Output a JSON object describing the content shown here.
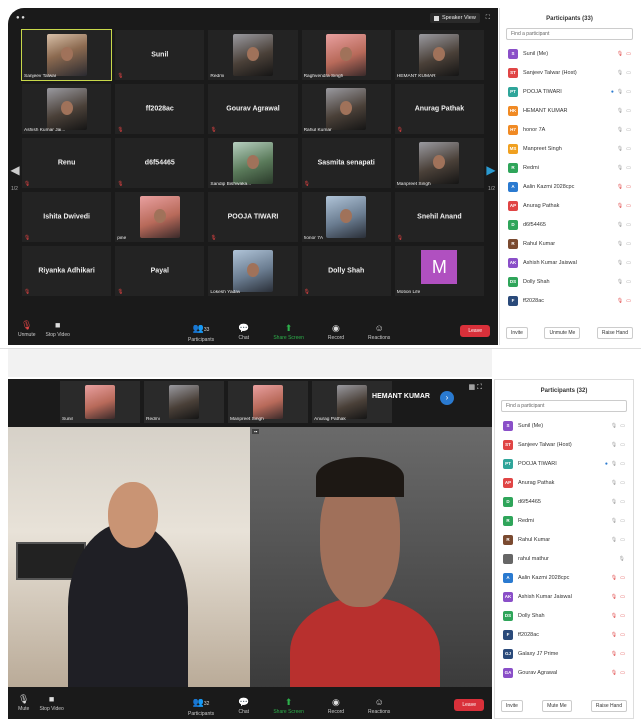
{
  "top": {
    "speaker_view": "Speaker View",
    "grid": [
      {
        "name": "Sanjeev Talwar",
        "type": "video",
        "tone": "warm",
        "active": true
      },
      {
        "name": "Sunil",
        "type": "name"
      },
      {
        "name": "Redmi",
        "type": "video",
        "tone": "dark"
      },
      {
        "name": "Raghvendra Singh",
        "type": "video",
        "tone": "pink"
      },
      {
        "name": "HEMANT KUMAR",
        "type": "video",
        "tone": "dark"
      },
      {
        "name": "Ashish Kumar Jai...",
        "type": "video",
        "tone": "dark"
      },
      {
        "name": "ff2028ac",
        "type": "name"
      },
      {
        "name": "Gourav Agrawal",
        "type": "name"
      },
      {
        "name": "Rahul Kumar",
        "type": "video",
        "tone": "dark"
      },
      {
        "name": "Anurag Pathak",
        "type": "name"
      },
      {
        "name": "Renu",
        "type": "name"
      },
      {
        "name": "d6f54465",
        "type": "name"
      },
      {
        "name": "Sandip Bishwaka...",
        "type": "video",
        "tone": "green"
      },
      {
        "name": "Sasmita senapati",
        "type": "name"
      },
      {
        "name": "Manpreet Singh",
        "type": "video",
        "tone": "dark"
      },
      {
        "name": "Ishita Dwivedi",
        "type": "name"
      },
      {
        "name": "pine",
        "type": "video",
        "tone": "pink"
      },
      {
        "name": "POOJA TIWARI",
        "type": "name"
      },
      {
        "name": "honor 7A",
        "type": "video",
        "tone": "blue"
      },
      {
        "name": "Snehil Anand",
        "type": "name"
      },
      {
        "name": "Riyanka Adhikari",
        "type": "name"
      },
      {
        "name": "Payal",
        "type": "name"
      },
      {
        "name": "Lokesh Yadav",
        "type": "video",
        "tone": "blue"
      },
      {
        "name": "Dolly Shah",
        "type": "name"
      },
      {
        "name": "Motion Life",
        "type": "letter",
        "letter": "M"
      }
    ],
    "page_left": "1/2",
    "page_right": "1/2",
    "controls": {
      "unmute": "Unmute",
      "stop_video": "Stop Video",
      "participants": "Participants",
      "participants_count": "33",
      "chat": "Chat",
      "share": "Share Screen",
      "record": "Record",
      "reactions": "Reactions",
      "leave": "Leave"
    },
    "panel": {
      "title": "Participants (33)",
      "search": "Find a participant",
      "rows": [
        {
          "abbr": "S",
          "name": "Sunil (Me)",
          "color": "#8a4fc8",
          "icons": "mic-off video-off"
        },
        {
          "abbr": "ST",
          "name": "Sanjeev Talwar (Host)",
          "color": "#e04545",
          "icons": "mic video"
        },
        {
          "abbr": "PT",
          "name": "POOJA TIWARI",
          "color": "#2fa59a",
          "icons": "share mic video"
        },
        {
          "abbr": "HK",
          "name": "HEMANT KUMAR",
          "color": "#f08a24",
          "icons": "mic video"
        },
        {
          "abbr": "H7",
          "name": "honor 7A",
          "color": "#f08a24",
          "icons": "mic video"
        },
        {
          "abbr": "MS",
          "name": "Manpreet Singh",
          "color": "#f0a020",
          "icons": "mic video"
        },
        {
          "abbr": "R",
          "name": "Redmi",
          "color": "#2fa55a",
          "icons": "mic video"
        },
        {
          "abbr": "A",
          "name": "Aalin Kazmi 2028cpc",
          "color": "#2a7ad0",
          "icons": "mic-off video-off"
        },
        {
          "abbr": "AP",
          "name": "Anurag Pathak",
          "color": "#e04545",
          "icons": "mic-off video-off"
        },
        {
          "abbr": "D",
          "name": "d6f54465",
          "color": "#2fa55a",
          "icons": "mic video"
        },
        {
          "abbr": "R",
          "name": "Rahul Kumar",
          "color": "#7a4a30",
          "icons": "mic video"
        },
        {
          "abbr": "AK",
          "name": "Ashish Kumar Jaiswal",
          "color": "#8a4fc8",
          "icons": "mic video"
        },
        {
          "abbr": "DS",
          "name": "Dolly Shah",
          "color": "#2fa55a",
          "icons": "mic video"
        },
        {
          "abbr": "F",
          "name": "ff2028ac",
          "color": "#2a4a7a",
          "icons": "mic-off video-off"
        }
      ],
      "invite": "Invite",
      "mute_all": "Unmute Me",
      "raise_hand": "Raise Hand"
    }
  },
  "bottom": {
    "strip": [
      {
        "name": "Sunil"
      },
      {
        "name": "Redmi"
      },
      {
        "name": "Manpreet Singh"
      },
      {
        "name": "Anurag Pathak"
      }
    ],
    "hemant": "HEMANT KUMAR",
    "controls": {
      "mute": "Mute",
      "stop_video": "Stop Video",
      "participants": "Participants",
      "participants_count": "32",
      "chat": "Chat",
      "share": "Share Screen",
      "record": "Record",
      "reactions": "Reactions",
      "leave": "Leave"
    },
    "panel": {
      "title": "Participants (32)",
      "search": "Find a participant",
      "rows": [
        {
          "abbr": "S",
          "name": "Sunil (Me)",
          "color": "#8a4fc8",
          "icons": "mic video"
        },
        {
          "abbr": "ST",
          "name": "Sanjeev Talwar (Host)",
          "color": "#e04545",
          "icons": "mic video"
        },
        {
          "abbr": "PT",
          "name": "POOJA TIWARI",
          "color": "#2fa59a",
          "icons": "share mic video"
        },
        {
          "abbr": "AP",
          "name": "Anurag Pathak",
          "color": "#e04545",
          "icons": "mic video"
        },
        {
          "abbr": "D",
          "name": "d6f54465",
          "color": "#2fa55a",
          "icons": "mic video"
        },
        {
          "abbr": "R",
          "name": "Redmi",
          "color": "#2fa55a",
          "icons": "mic video"
        },
        {
          "abbr": "R",
          "name": "Rahul Kumar",
          "color": "#7a4a30",
          "icons": "mic video"
        },
        {
          "abbr": "",
          "name": "rahul mathur",
          "color": "#666",
          "icons": "mic"
        },
        {
          "abbr": "A",
          "name": "Aalin Kazmi 2028cpc",
          "color": "#2a7ad0",
          "icons": "mic-off video-off"
        },
        {
          "abbr": "AK",
          "name": "Ashish Kumar Jaiswal",
          "color": "#8a4fc8",
          "icons": "mic-off video-off"
        },
        {
          "abbr": "DS",
          "name": "Dolly Shah",
          "color": "#2fa55a",
          "icons": "mic-off video-off"
        },
        {
          "abbr": "F",
          "name": "ff2028ac",
          "color": "#2a4a7a",
          "icons": "mic-off video-off"
        },
        {
          "abbr": "GJ",
          "name": "Galaxy J7 Prime",
          "color": "#2a4a7a",
          "icons": "mic-off video-off"
        },
        {
          "abbr": "GA",
          "name": "Gourav Agrawal",
          "color": "#8a4fc8",
          "icons": "mic-off video-off"
        }
      ],
      "invite": "Invite",
      "mute_me": "Mute Me",
      "raise_hand": "Raise Hand"
    }
  }
}
